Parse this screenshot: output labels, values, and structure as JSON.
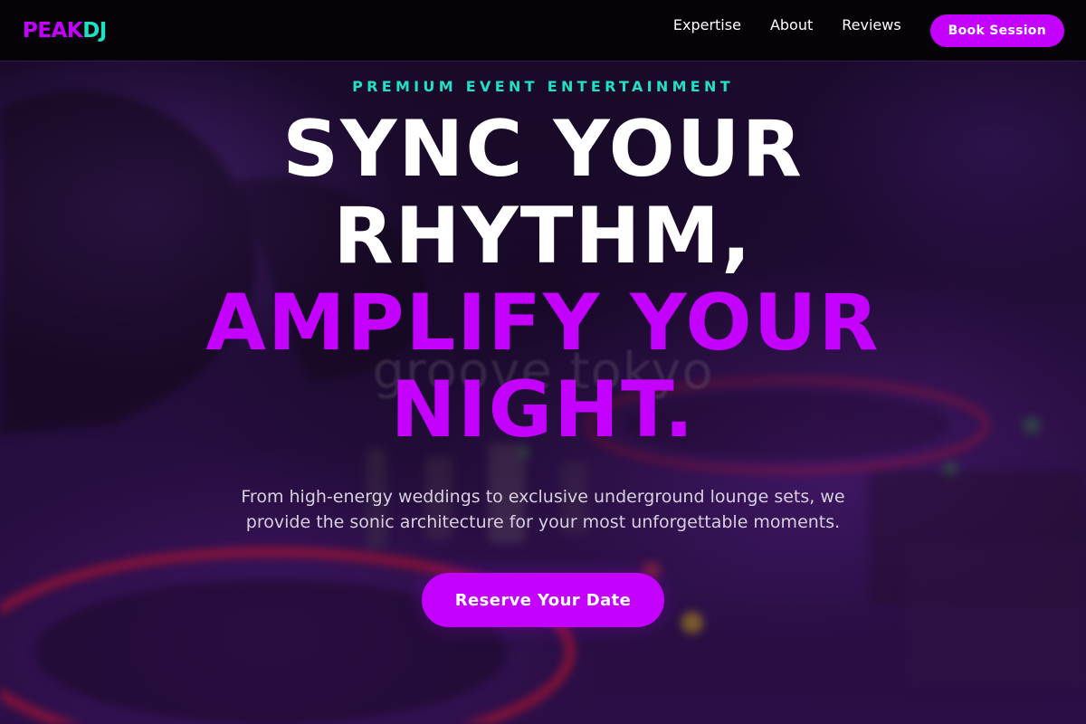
{
  "nav": {
    "logo_primary": "PEAK",
    "logo_secondary": "DJ",
    "links": [
      {
        "label": "Expertise"
      },
      {
        "label": "About"
      },
      {
        "label": "Reviews"
      }
    ],
    "cta_label": "Book Session"
  },
  "hero": {
    "eyebrow": "PREMIUM EVENT ENTERTAINMENT",
    "headline_line1": "SYNC YOUR",
    "headline_line2": "RHYTHM,",
    "headline_line3": "AMPLIFY YOUR",
    "headline_line4": "NIGHT.",
    "subtext": "From high-energy weddings to exclusive underground lounge sets, we provide the sonic architecture for your most unforgettable moments.",
    "cta_label": "Reserve Your Date"
  },
  "background": {
    "watermark_text": "groove tokyo"
  },
  "colors": {
    "accent": "#c400ff",
    "teal": "#1fe0c0",
    "nav_bg": "#050208",
    "text": "#ffffff"
  }
}
